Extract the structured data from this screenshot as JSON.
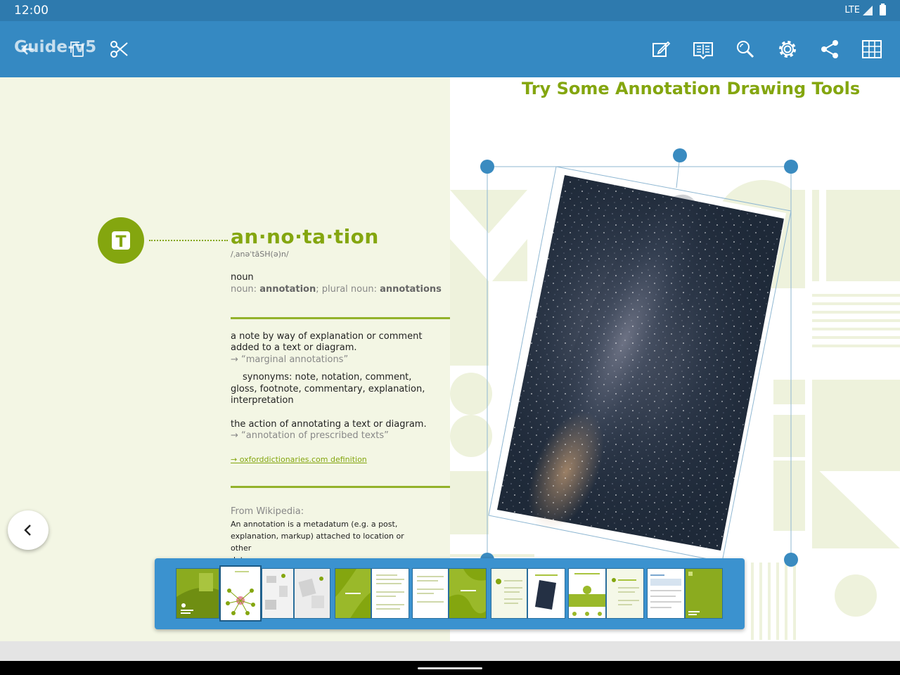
{
  "status": {
    "time": "12:00",
    "network": "LTE"
  },
  "toolbar": {
    "title": "Guide-v5",
    "icons": [
      "back-arrow-icon",
      "copy-icon",
      "scissors-icon",
      "edit-icon",
      "reader-mode-icon",
      "search-icon",
      "settings-icon",
      "share-icon",
      "thumbnails-icon"
    ]
  },
  "left_page": {
    "badge_letter": "T",
    "word": "an·no·ta·tion",
    "phonetic": "/ˌanəˈtāSH(ə)n/",
    "pos": "noun",
    "forms": {
      "prefix": "noun: ",
      "singular": "annotation",
      "mid": "; plural noun: ",
      "plural": "annotations"
    },
    "def1_line1": "a note by way of explanation or comment",
    "def1_line2": "added to a text or diagram.",
    "def1_example": "→ “marginal annotations”",
    "synonyms_line1": "synonyms: note, notation, comment,",
    "synonyms_line2": "gloss, footnote, commentary, explanation,",
    "synonyms_line3": "interpretation",
    "def2": "the action of annotating a text or diagram.",
    "def2_example": "→ “annotation of prescribed texts”",
    "link": "→ oxforddictionaries.com definition",
    "wiki_heading": "From Wikipedia:",
    "wiki_line1": "An annotation is a metadatum (e.g. a post,",
    "wiki_line2": "explanation, markup) attached to location or other",
    "wiki_line3": "data."
  },
  "right_page": {
    "title": "Try Some Annotation Drawing Tools"
  },
  "colors": {
    "statusbar": "#2e7aae",
    "toolbar": "#3589c2",
    "accent": "#84a60f",
    "handle": "#3a8bc0",
    "thumbnail_strip": "#3b92cf"
  },
  "thumbnails": {
    "count": 14,
    "selected_index": 1
  }
}
